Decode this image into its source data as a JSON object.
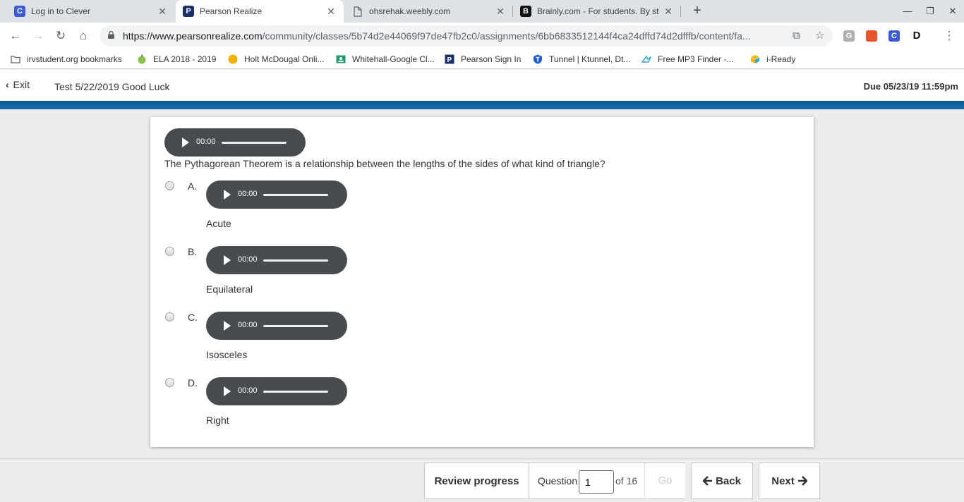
{
  "browser": {
    "tabs": [
      {
        "title": "Log in to Clever",
        "favicon": "C",
        "color": "#3b5bdb"
      },
      {
        "title": "Pearson Realize",
        "favicon": "P",
        "color": "#1b2f6b"
      },
      {
        "title": "ohsrehak.weebly.com",
        "favicon": "document-icon",
        "color": "#5f6368"
      },
      {
        "title": "Brainly.com - For students. By st",
        "favicon": "B",
        "color": "#111111"
      }
    ],
    "url_host": "https://www.pearsonrealize.com",
    "url_path": "/community/classes/5b74d2e44069f97de47fb2c0/assignments/6bb6833512144f4ca24dffd74d2dfffb/content/fa...",
    "bookmarks": [
      {
        "label": "irvstudent.org bookmarks",
        "icon": "folder-icon"
      },
      {
        "label": "ELA 2018 - 2019",
        "icon": "apple-icon"
      },
      {
        "label": "Holt McDougal Onli...",
        "icon": "circle-icon"
      },
      {
        "label": "Whitehall-Google Cl...",
        "icon": "classroom-icon"
      },
      {
        "label": "Pearson Sign In",
        "icon": "pearson-icon"
      },
      {
        "label": "Tunnel | Ktunnel, Dt...",
        "icon": "shield-icon"
      },
      {
        "label": "Free MP3 Finder -...",
        "icon": "bird-icon"
      },
      {
        "label": "i-Ready",
        "icon": "cube-icon"
      }
    ]
  },
  "header": {
    "exit_label": "Exit",
    "test_title": "Test 5/22/2019 Good Luck",
    "due": "Due 05/23/19 11:59pm"
  },
  "question": {
    "audio_time": "00:00",
    "text": "The Pythagorean Theorem is a relationship between the lengths of the sides of what kind of triangle?",
    "options": [
      {
        "letter": "A.",
        "text": "Acute",
        "time": "00:00"
      },
      {
        "letter": "B.",
        "text": "Equilateral",
        "time": "00:00"
      },
      {
        "letter": "C.",
        "text": "Isosceles",
        "time": "00:00"
      },
      {
        "letter": "D.",
        "text": "Right",
        "time": "00:00"
      }
    ]
  },
  "footer": {
    "review_label": "Review progress",
    "question_label": "Question",
    "question_value": "1",
    "of_label": "of 16",
    "go_label": "Go",
    "back_label": "Back",
    "next_label": "Next"
  },
  "colors": {
    "blue_bar": "#0d5b94",
    "audio_bg": "#494c4f"
  }
}
